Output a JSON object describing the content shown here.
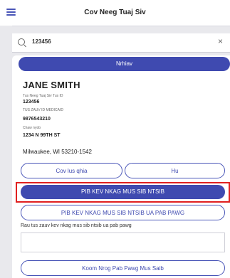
{
  "header": {
    "title": "Cov Neeg Tuaj Siv"
  },
  "search": {
    "value": "123456"
  },
  "primary_button": {
    "label": "Nrhiav"
  },
  "patient": {
    "name": "JANE SMITH",
    "id_label": "Tus Neeg Tuaj Siv Tus ID",
    "id_value": "123456",
    "medicaid_label": "TUS ZAUV ID MEDICAID",
    "medicaid_value": "9876543210",
    "address_label": "Chaw nyob",
    "address_line": "1234 N 99TH ST",
    "city_line": "Milwaukee, WI 53210-1542"
  },
  "actions": {
    "directions": "Cov lus qhia",
    "call": "Hu",
    "record_trip": "PIB KEV NKAG MUS SIB NTSIB",
    "record_trip_pab_pawg": "PIB KEV NKAG MUS SIB NTSIB UA PAB PAWG",
    "note_caption": "Rau tus zauv kev nkag mus sib ntsib ua pab pawg",
    "start_group": "Koom Nrog Pab Pawg Mus Saib"
  }
}
